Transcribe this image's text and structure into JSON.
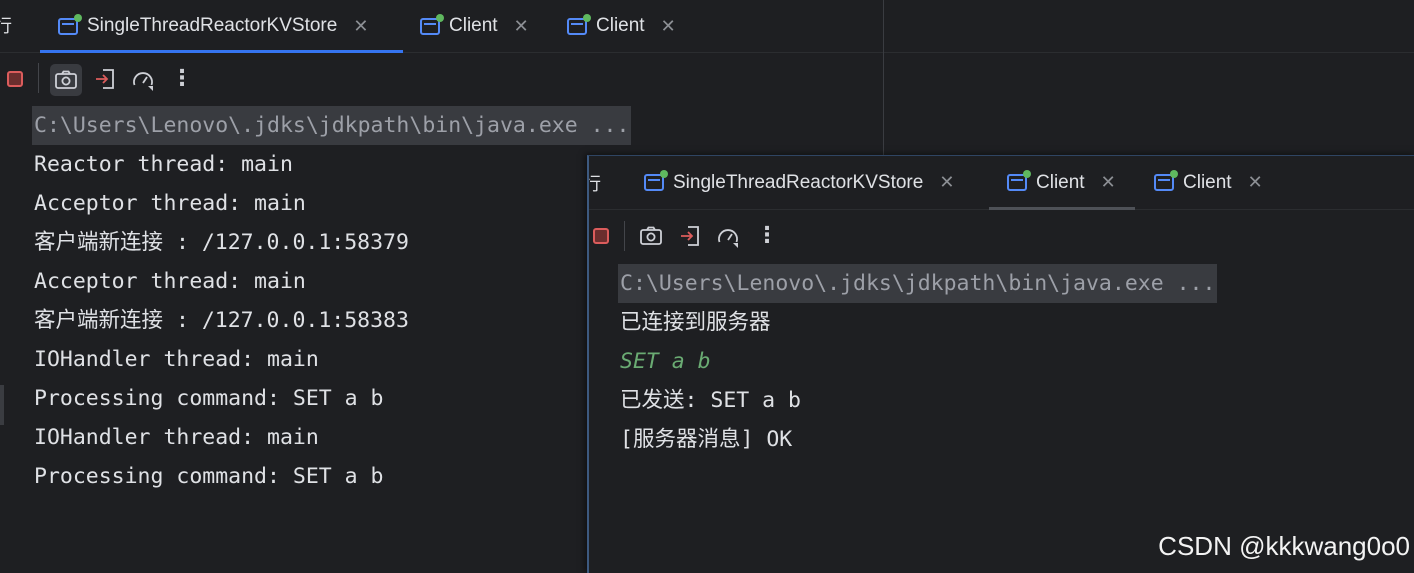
{
  "left_panel": {
    "left_fragment": "行",
    "tabs": [
      {
        "label": "SingleThreadReactorKVStore",
        "active": true
      },
      {
        "label": "Client",
        "active": false
      },
      {
        "label": "Client",
        "active": false
      }
    ],
    "console": {
      "command": "C:\\Users\\Lenovo\\.jdks\\jdkpath\\bin\\java.exe ...",
      "lines": [
        "Reactor thread: main",
        "Acceptor thread: main",
        "客户端新连接 : /127.0.0.1:58379",
        "Acceptor thread: main",
        "客户端新连接 : /127.0.0.1:58383",
        "IOHandler thread: main",
        "Processing command: SET a b",
        "IOHandler thread: main",
        "Processing command: SET a b"
      ]
    }
  },
  "right_panel": {
    "left_fragment": "行",
    "tabs": [
      {
        "label": "SingleThreadReactorKVStore",
        "active": false
      },
      {
        "label": "Client",
        "active": true
      },
      {
        "label": "Client",
        "active": false
      }
    ],
    "console": {
      "command": "C:\\Users\\Lenovo\\.jdks\\jdkpath\\bin\\java.exe ...",
      "line1": "已连接到服务器",
      "user_input": "SET a b",
      "line3": "已发送: SET a b",
      "line4": "[服务器消息] OK"
    }
  },
  "watermark": "CSDN @kkkwang0o0",
  "icons": {
    "stop": "stop-icon",
    "camera": "camera-icon",
    "login": "login-icon",
    "gauge": "gauge-icon",
    "more": "more-vertical-icon"
  },
  "colors": {
    "background": "#1e1f22",
    "accent": "#3574f0",
    "text": "#dfe1e5",
    "input_text": "#6aab73",
    "stop": "#db5c5c"
  }
}
